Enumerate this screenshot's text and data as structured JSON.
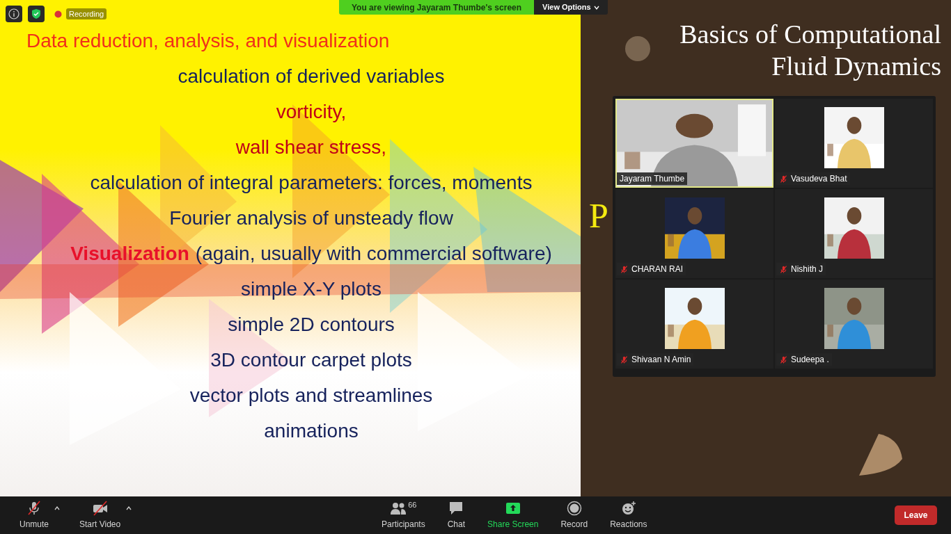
{
  "meeting_bar": {
    "recording_label": "Recording",
    "viewing_banner": "You are viewing Jayaram Thumbe's screen",
    "view_options": "View Options"
  },
  "slide": {
    "lines": [
      {
        "kind": "heading",
        "text": "Data reduction, analysis, and visualization"
      },
      {
        "kind": "body",
        "text": "calculation of derived variables"
      },
      {
        "kind": "accent",
        "text": "vorticity,"
      },
      {
        "kind": "accent",
        "text": "wall shear stress,"
      },
      {
        "kind": "body",
        "text": "calculation of integral parameters:  forces, moments"
      },
      {
        "kind": "body",
        "text": "Fourier analysis of unsteady flow"
      },
      {
        "kind": "body",
        "lead": "Visualization",
        "text": "(again, usually with commercial software)"
      },
      {
        "kind": "body",
        "text": "simple X-Y plots"
      },
      {
        "kind": "body",
        "text": "simple 2D contours"
      },
      {
        "kind": "body",
        "text": "3D contour carpet plots"
      },
      {
        "kind": "body",
        "text": "vector plots and streamlines"
      },
      {
        "kind": "body",
        "text": "animations"
      }
    ]
  },
  "side_slide": {
    "title_lines": [
      "Basics of Computational",
      "Fluid Dynamics"
    ],
    "partial_text": "P"
  },
  "gallery": {
    "tiles": [
      {
        "name": "Jayaram Thumbe",
        "kind": "video",
        "active_speaker": true,
        "muted": false
      },
      {
        "name": "Vasudeva Bhat",
        "active_speaker": false,
        "muted": true
      },
      {
        "name": "CHARAN RAI",
        "active_speaker": false,
        "muted": true
      },
      {
        "name": "Nishith J",
        "active_speaker": false,
        "muted": true
      },
      {
        "name": "Shivaan N Amin",
        "active_speaker": false,
        "muted": true
      },
      {
        "name": "Sudeepa .",
        "active_speaker": false,
        "muted": true
      }
    ]
  },
  "toolbar": {
    "items": [
      {
        "label": "Unmute",
        "kind": "mic_off",
        "caret": true
      },
      {
        "label": "Start Video",
        "kind": "video_off",
        "caret": true
      },
      {
        "label": "Participants",
        "kind": "participants",
        "count": "66"
      },
      {
        "label": "Chat",
        "kind": "chat"
      },
      {
        "label": "Share Screen",
        "kind": "share"
      },
      {
        "label": "Record",
        "kind": "record"
      },
      {
        "label": "Reactions",
        "kind": "reactions"
      }
    ],
    "leave": "Leave"
  }
}
